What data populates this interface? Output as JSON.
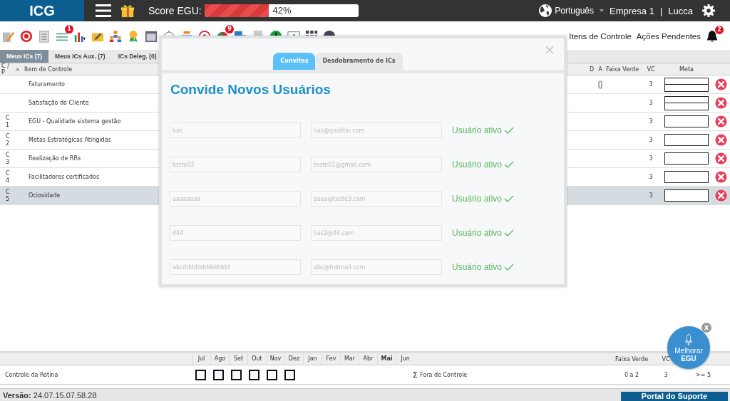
{
  "header": {
    "logo": "ICG",
    "score_label": "Score EGU:",
    "score": {
      "level": 0.42,
      "reading": "42%"
    },
    "language": "Português",
    "company": "Empresa 1",
    "separator": "|",
    "user": "Lucca"
  },
  "toolbar": {
    "badges": [
      "1",
      "9"
    ],
    "links": [
      "Itens de Controle",
      "Ações Pendentes"
    ],
    "notifications": "2"
  },
  "tabs": [
    {
      "label": "Meus ICs (7)",
      "selected": true
    },
    {
      "label": "Meus ICs Aux. (7)",
      "selected": false
    },
    {
      "label": "ICs Deleg. (0)",
      "selected": false
    }
  ],
  "table": {
    "columns": [
      "C / P",
      "Item de Controle",
      "D",
      "A",
      "Faixa Verde",
      "VC",
      "Meta"
    ],
    "rows": [
      {
        "cp": [],
        "item": "Faturamento",
        "attachment": true,
        "vc": "3",
        "kind": "split",
        "selected": false
      },
      {
        "cp": [],
        "item": "Satisfação do Cliente",
        "attachment": false,
        "vc": "3",
        "kind": "split",
        "selected": false
      },
      {
        "cp": [
          "C",
          "1"
        ],
        "item": "EGU - Qualidade sistema gestão",
        "attachment": false,
        "vc": "3",
        "kind": "single",
        "selected": false
      },
      {
        "cp": [
          "C",
          "2"
        ],
        "item": "Metas Estratégicas Atingidas",
        "attachment": false,
        "vc": "3",
        "kind": "single",
        "selected": false
      },
      {
        "cp": [
          "C",
          "3"
        ],
        "item": "Realização de RRs",
        "attachment": false,
        "vc": "3",
        "kind": "single",
        "selected": false
      },
      {
        "cp": [
          "C",
          "4"
        ],
        "item": "Facilitadores certificados",
        "attachment": false,
        "vc": "3",
        "kind": "single",
        "selected": false
      },
      {
        "cp": [
          "C",
          "5"
        ],
        "item": "Ociosidade",
        "attachment": false,
        "vc": "3",
        "kind": "single",
        "selected": true
      }
    ]
  },
  "modal": {
    "tabs": [
      {
        "label": "Convites",
        "selected": true
      },
      {
        "label": "Desdobramento de ICs",
        "selected": false
      }
    ],
    "title": "Convide Novos Usuários",
    "invites": [
      {
        "name": "luis",
        "email": "luis@qualitin.com",
        "status": "Usuário ativo"
      },
      {
        "name": "teste02",
        "email": "teste01@gmail.com",
        "status": "Usuário ativo"
      },
      {
        "name": "aaaaaaaa",
        "email": "aaaa@teste3.com",
        "status": "Usuário ativo"
      },
      {
        "name": "444",
        "email": "luis2@44.com",
        "status": "Usuário ativo"
      },
      {
        "name": "abcddddddddddddd",
        "email": "abc@hotmail.com",
        "status": "Usuário ativo"
      }
    ]
  },
  "routine": {
    "months": [
      {
        "label": "Jul",
        "current": false,
        "kind": "box"
      },
      {
        "label": "Ago",
        "current": false,
        "kind": "box"
      },
      {
        "label": "Set",
        "current": false,
        "kind": "box"
      },
      {
        "label": "Out",
        "current": false,
        "kind": "box"
      },
      {
        "label": "Nov",
        "current": false,
        "kind": "box"
      },
      {
        "label": "Dez",
        "current": false,
        "kind": "box"
      },
      {
        "label": "Jan",
        "current": false,
        "kind": "blank"
      },
      {
        "label": "Fev",
        "current": false,
        "kind": "blank"
      },
      {
        "label": "Mar",
        "current": false,
        "kind": "blank"
      },
      {
        "label": "Abr",
        "current": false,
        "kind": "blank"
      },
      {
        "label": "Mai",
        "current": true,
        "kind": "blank"
      },
      {
        "label": "Jun",
        "current": false,
        "kind": "blank"
      }
    ],
    "columns": [
      "Faixa Verde",
      "VC"
    ],
    "name": "Controle da Rotina",
    "sum_label": "Fora de Controle",
    "sum_symbol": "Σ",
    "faixa": "0 a 2",
    "vc": "3",
    "meta": ">= 5"
  },
  "floating": {
    "close": "x",
    "label": "Melhorar",
    "label_bold": "EGU"
  },
  "footer": {
    "version_label": "Versão:",
    "version": "24.07.15.07.58.28",
    "support": "Portal do Suporte"
  }
}
